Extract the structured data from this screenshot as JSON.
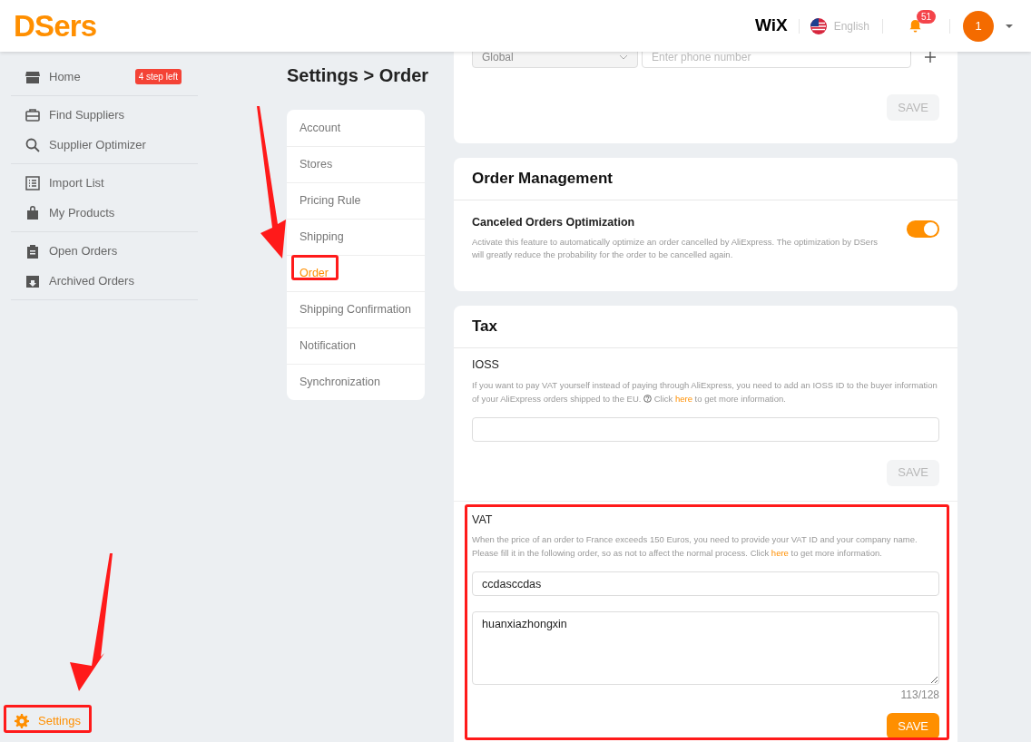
{
  "header": {
    "logo": "DSers",
    "platform": "WiX",
    "language": "English",
    "notifications": "51",
    "avatar": "1"
  },
  "sidebar": {
    "groups": [
      [
        {
          "kind": "store",
          "label": "Home",
          "badge": "4 step left",
          "selected": false
        }
      ],
      [
        {
          "kind": "briefcase",
          "label": "Find Suppliers",
          "selected": false
        },
        {
          "kind": "search",
          "label": "Supplier Optimizer",
          "selected": false
        }
      ],
      [
        {
          "kind": "list",
          "label": "Import List",
          "selected": false
        },
        {
          "kind": "bag",
          "label": "My Products",
          "selected": false
        }
      ],
      [
        {
          "kind": "clipboard",
          "label": "Open Orders",
          "selected": false
        },
        {
          "kind": "archive",
          "label": "Archived Orders",
          "selected": false
        }
      ]
    ],
    "footer": {
      "kind": "gear",
      "label": "Settings",
      "selected": true
    }
  },
  "page_title": "Settings > Order",
  "settings_menu": [
    {
      "label": "Account",
      "selected": false
    },
    {
      "label": "Stores",
      "selected": false
    },
    {
      "label": "Pricing Rule",
      "selected": false
    },
    {
      "label": "Shipping",
      "selected": false
    },
    {
      "label": "Order",
      "selected": true
    },
    {
      "label": "Shipping Confirmation",
      "selected": false
    },
    {
      "label": "Notification",
      "selected": false
    },
    {
      "label": "Synchronization",
      "selected": false
    }
  ],
  "contact": {
    "country": "Global",
    "phone_placeholder": "Enter phone number",
    "save": {
      "label": "SAVE",
      "disabled": true
    }
  },
  "order_management": {
    "title": "Order Management",
    "settings": [
      {
        "title": "Canceled Orders Optimization",
        "description": "Activate this feature to automatically optimize an order cancelled by AliExpress. The optimization by DSers will greatly reduce the probability for the order to be cancelled again.",
        "on": true
      }
    ]
  },
  "tax": {
    "title": "Tax",
    "ioss": {
      "title": "IOSS",
      "description": "If you want to pay VAT yourself instead of paying through AliExpress, you need to add an IOSS ID to the buyer information of your AliExpress orders shipped to the EU.",
      "help_text": "Click",
      "link": "here",
      "after_link": "to get more information.",
      "save": {
        "label": "SAVE",
        "disabled": true
      }
    },
    "vat": {
      "title": "VAT",
      "description": "When the price of an order to France exceeds 150 Euros, you need to provide your VAT ID and your company name. Please fill it in the following order, so as not to affect the normal process. Click",
      "link": "here",
      "after_link": "to get more information.",
      "vat_id": "ccdasccdas",
      "company": "huanxiazhongxin",
      "counter": "113/128",
      "save": {
        "label": "SAVE",
        "disabled": false
      }
    }
  }
}
